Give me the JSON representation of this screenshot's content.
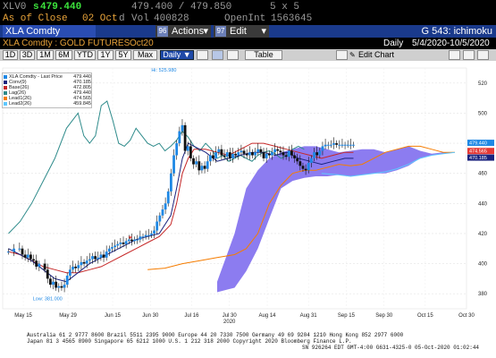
{
  "quote": {
    "ticker": "XLV0",
    "last_prefix": "s",
    "last": "479.440",
    "range": "479.400 / 479.850",
    "size": "5 x 5",
    "close_label": "As of Close",
    "close_date": "02 Oct",
    "close_suffix": "d",
    "vol_label": "Vol",
    "vol": "400828",
    "openint_label": "OpenInt",
    "openint": "1563645"
  },
  "function_bar": {
    "security": "XLA Comdty",
    "actions_num": "96",
    "actions_label": "Actions",
    "edit_num": "97",
    "edit_label": "Edit",
    "arrow": "▾",
    "title": "G 543: ichimoku"
  },
  "sub_bar": {
    "description": "XLA Comdty : GOLD FUTURES",
    "contract": "Oct20",
    "period": "Daily",
    "date_range": "5/4/2020-10/5/2020"
  },
  "toolbar": {
    "ranges": [
      "1D",
      "3D",
      "1M",
      "6M",
      "YTD",
      "1Y",
      "5Y",
      "Max"
    ],
    "interval": "Daily ▼",
    "table_label": "Table",
    "edit_chart_label": "Edit Chart"
  },
  "legend": {
    "items": [
      {
        "label": "XLA Comdty - Last Price",
        "value": "479.440",
        "color": "#1e88e5"
      },
      {
        "label": "Conv(9)",
        "value": "470.185",
        "color": "#1a237e"
      },
      {
        "label": "Base(26)",
        "value": "472.805",
        "color": "#c62828"
      },
      {
        "label": "Lag(26)",
        "value": "479.440",
        "color": "#2e8b8b"
      },
      {
        "label": "Lead1(26)",
        "value": "474.565",
        "color": "#f57c00"
      },
      {
        "label": "Lead2(26)",
        "value": "459.845",
        "color": "#5ec8ff"
      }
    ]
  },
  "chart_data": {
    "type": "line",
    "x_ticks": [
      "May 15",
      "May 29",
      "Jun 15",
      "Jun 30",
      "Jul 16",
      "Jul 30",
      "Aug 14",
      "Aug 31",
      "Sep 15",
      "Sep 30",
      "Oct 15",
      "Oct 30"
    ],
    "year_label": "2020",
    "y_ticks": [
      380,
      400,
      420,
      440,
      460,
      480,
      500,
      520
    ],
    "ylim": [
      370,
      530
    ],
    "annotations": [
      {
        "text": "Hi: 525.980",
        "value": 525.98
      },
      {
        "text": "Low: 381.000",
        "value": 381.0
      }
    ],
    "right_labels": [
      {
        "text": "479.440",
        "color": "#1e88e5"
      },
      {
        "text": "474.565",
        "color": "#e53935"
      },
      {
        "text": "470.185",
        "color": "#1a237e"
      }
    ],
    "series": [
      {
        "name": "Last Price",
        "kind": "candles",
        "x": [
          2,
          4,
          6,
          7,
          8,
          9,
          10,
          11,
          12,
          13,
          15,
          16,
          17,
          18,
          19,
          20,
          21,
          22,
          23,
          24,
          25,
          26,
          27,
          28,
          29,
          30,
          31,
          32,
          33,
          34,
          35,
          36,
          37,
          38,
          39,
          40,
          41,
          42,
          43,
          44,
          45,
          46,
          47,
          48,
          49,
          50,
          51,
          52,
          53,
          54,
          55,
          56,
          57,
          58,
          59,
          60,
          61,
          62,
          63,
          64,
          65,
          66,
          67,
          68,
          69,
          70,
          71,
          72,
          73,
          74,
          75,
          76,
          77,
          78,
          79,
          80,
          81,
          82,
          83,
          84,
          85,
          86,
          87,
          88,
          89,
          90,
          91,
          92,
          93,
          94,
          95,
          96,
          97,
          98,
          99,
          100,
          101,
          102,
          103,
          104,
          105,
          106,
          107,
          108,
          109,
          110,
          111,
          112,
          113,
          114,
          115,
          116,
          117,
          118,
          119,
          120,
          121,
          122,
          123,
          124,
          125
        ],
        "y": [
          408,
          410,
          410,
          406,
          404,
          406,
          403,
          402,
          398,
          400,
          396,
          390,
          386,
          388,
          384,
          385,
          384,
          386,
          392,
          396,
          398,
          397,
          399,
          401,
          400,
          402,
          403,
          405,
          403,
          404,
          406,
          404,
          408,
          410,
          411,
          412,
          413,
          414,
          413,
          415,
          416,
          415,
          416,
          416,
          418,
          418,
          419,
          419,
          420,
          422,
          428,
          432,
          436,
          440,
          448,
          460,
          472,
          480,
          488,
          492,
          475,
          478,
          470,
          466,
          468,
          462,
          465,
          463,
          468,
          472,
          470,
          474,
          476,
          472,
          471,
          474,
          470,
          473,
          472,
          474,
          475,
          473,
          472,
          474,
          472,
          474,
          476,
          474,
          470,
          473,
          472,
          474,
          476,
          475,
          474,
          472,
          471,
          475,
          472,
          470,
          468,
          465,
          463,
          462,
          467,
          470,
          474,
          472,
          475,
          478,
          479,
          479,
          479,
          480,
          479,
          479,
          479,
          479,
          479,
          479,
          479
        ]
      },
      {
        "name": "Conv(9)",
        "y_end": 470.185
      },
      {
        "name": "Base(26)",
        "y_end": 472.805
      },
      {
        "name": "Lag(26)",
        "y_end": 479.44
      },
      {
        "name": "Lead1(26)",
        "y_end": 474.565
      },
      {
        "name": "Lead2(26)",
        "y_end": 459.845
      }
    ]
  },
  "footer": {
    "line1": "Australia 61 2 9777 8600 Brazil 5511 2395 9000 Europe 44 20 7330 7500 Germany 49 69 9204 1210 Hong Kong 852 2977 6000",
    "line2": "Japan 81 3 4565 8900        Singapore 65 6212 1000     U.S. 1 212 318 2000        Copyright 2020 Bloomberg Finance L.P.",
    "line3": "SN 926264 EDT  GMT-4:00 G631-4325-0 05-Oct-2020 01:02:44"
  }
}
